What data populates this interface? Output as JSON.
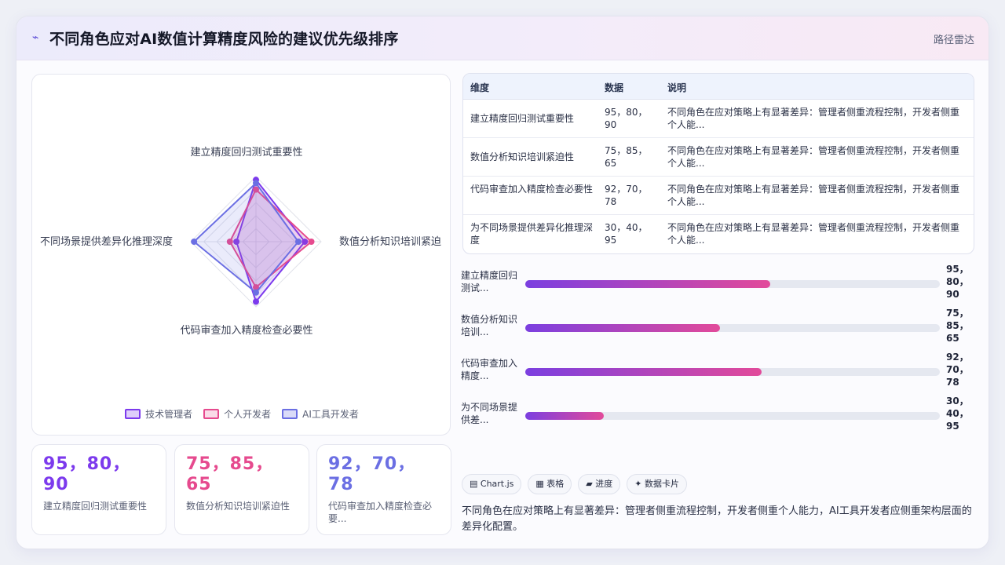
{
  "header": {
    "icon": "chart-line-icon",
    "title": "不同角色应对AI数值计算精度风险的建议优先级排序",
    "link_label": "路径雷达"
  },
  "colors": {
    "series": [
      "#7c3aed",
      "#e64a8e",
      "#6b6fe3"
    ]
  },
  "chart_data": {
    "type": "radar",
    "axes": [
      "建立精度回归测试重要性",
      "数值分析知识培训紧迫性",
      "代码审查加入精度检查必要性",
      "不同场景提供差异化推理深度"
    ],
    "axis_labels_display": [
      "建立精度回归测试重要性",
      "数值分析知识培训紧迫",
      "代码审查加入精度检查必要性",
      "不同场景提供差异化推理深度"
    ],
    "range": [
      0,
      100
    ],
    "grid_levels": 5,
    "legend_position": "bottom",
    "series": [
      {
        "name": "技术管理者",
        "values": [
          95,
          75,
          92,
          30
        ]
      },
      {
        "name": "个人开发者",
        "values": [
          80,
          85,
          70,
          40
        ]
      },
      {
        "name": "AI工具开发者",
        "values": [
          90,
          65,
          78,
          95
        ]
      }
    ]
  },
  "stats": [
    {
      "value": "95，80，90",
      "label": "建立精度回归测试重要性"
    },
    {
      "value": "75，85，65",
      "label": "数值分析知识培训紧迫性"
    },
    {
      "value": "92，70，78",
      "label": "代码审查加入精度检查必要..."
    }
  ],
  "table": {
    "headers": [
      "维度",
      "数据",
      "说明"
    ],
    "rows": [
      {
        "dim": "建立精度回归测试重要性",
        "data": "95，80，90",
        "note": "不同角色在应对策略上有显著差异：管理者侧重流程控制，开发者侧重个人能..."
      },
      {
        "dim": "数值分析知识培训紧迫性",
        "data": "75，85，65",
        "note": "不同角色在应对策略上有显著差异：管理者侧重流程控制，开发者侧重个人能..."
      },
      {
        "dim": "代码审查加入精度检查必要性",
        "data": "92，70，78",
        "note": "不同角色在应对策略上有显著差异：管理者侧重流程控制，开发者侧重个人能..."
      },
      {
        "dim": "为不同场景提供差异化推理深度",
        "data": "30，40，95",
        "note": "不同角色在应对策略上有显著差异：管理者侧重流程控制，开发者侧重个人能..."
      }
    ]
  },
  "bars": [
    {
      "label": "建立精度回归测试...",
      "value": "95，80，90",
      "fill": 0.59
    },
    {
      "label": "数值分析知识培训...",
      "value": "75，85，65",
      "fill": 0.47
    },
    {
      "label": "代码审查加入精度...",
      "value": "92，70，78",
      "fill": 0.57
    },
    {
      "label": "为不同场景提供差...",
      "value": "30，40，95",
      "fill": 0.19
    }
  ],
  "tags": [
    "▤ Chart.js",
    "▦ 表格",
    "▰ 进度",
    "✦ 数据卡片"
  ],
  "summary": "不同角色在应对策略上有显著差异：管理者侧重流程控制，开发者侧重个人能力，AI工具开发者应侧重架构层面的差异化配置。"
}
